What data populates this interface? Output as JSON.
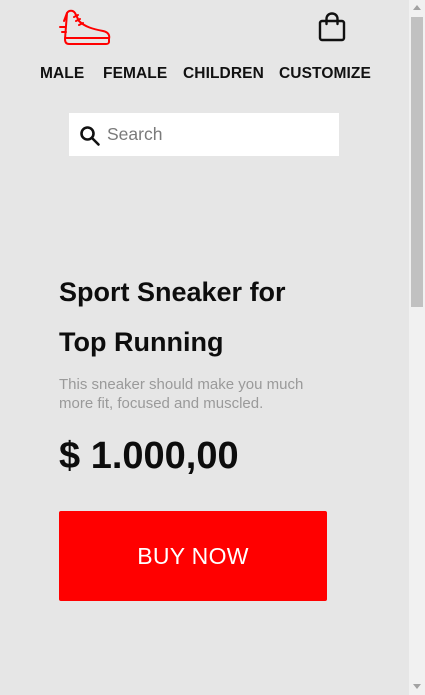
{
  "header": {
    "logo_icon": "sneaker-logo-icon",
    "cart_icon": "shopping-bag-icon",
    "brand_color": "#ff0000"
  },
  "nav": {
    "items": [
      {
        "label": "MALE"
      },
      {
        "label": "FEMALE"
      },
      {
        "label": "CHILDREN"
      },
      {
        "label": "CUSTOMIZE"
      }
    ]
  },
  "search": {
    "placeholder": "Search",
    "value": "",
    "icon": "search-icon"
  },
  "hero": {
    "title_line1": "Sport Sneaker for",
    "title_line2": "Top Running",
    "description": "This sneaker should make you much more fit, focused and muscled.",
    "price": "$ 1.000,00",
    "buy_label": "BUY NOW",
    "buy_color": "#ff0000"
  }
}
